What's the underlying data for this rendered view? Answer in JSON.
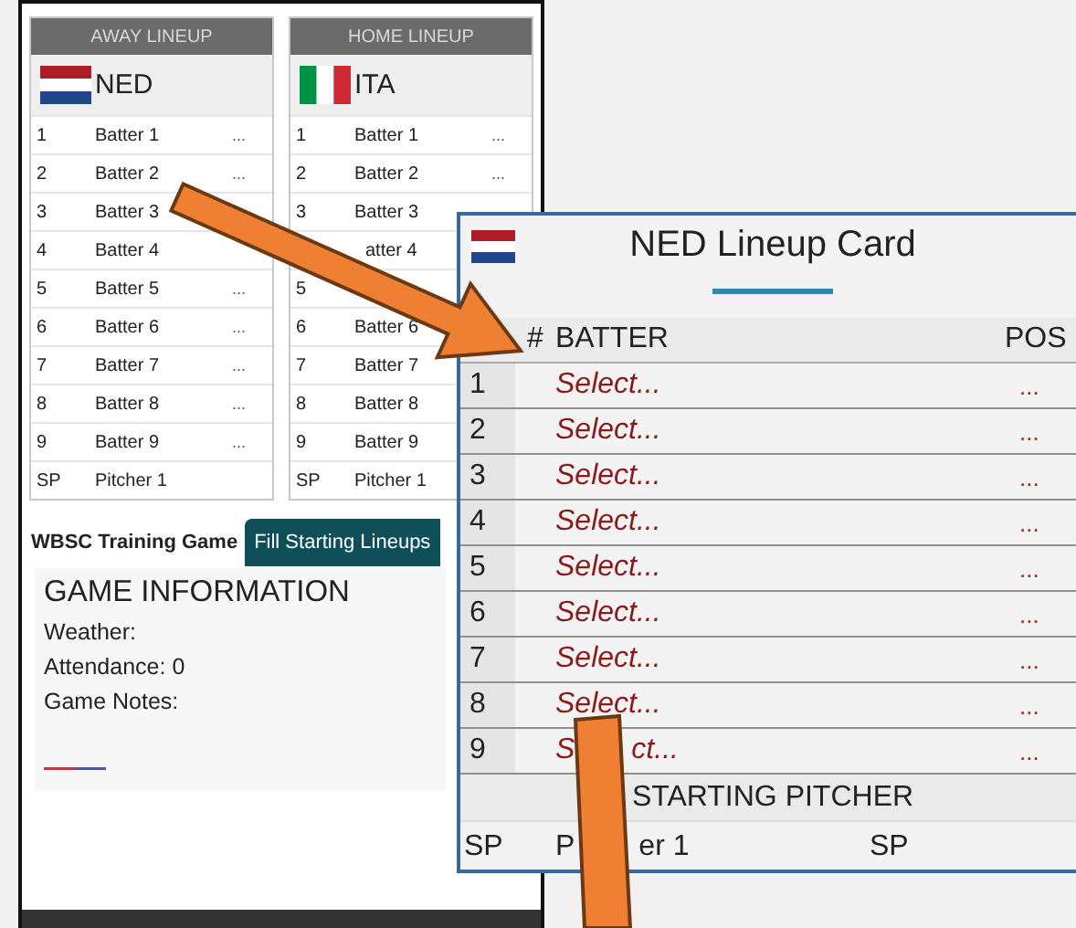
{
  "lineups": [
    {
      "heading": "AWAY LINEUP",
      "team": "NED",
      "rows": [
        {
          "num": "1",
          "name": "Batter 1",
          "pos": "..."
        },
        {
          "num": "2",
          "name": "Batter 2",
          "pos": "..."
        },
        {
          "num": "3",
          "name": "Batter 3"
        },
        {
          "num": "4",
          "name": "Batter 4"
        },
        {
          "num": "5",
          "name": "Batter 5",
          "pos": "..."
        },
        {
          "num": "6",
          "name": "Batter 6",
          "pos": "..."
        },
        {
          "num": "7",
          "name": "Batter 7",
          "pos": "..."
        },
        {
          "num": "8",
          "name": "Batter 8",
          "pos": "..."
        },
        {
          "num": "9",
          "name": "Batter 9",
          "pos": "..."
        },
        {
          "num": "SP",
          "name": "Pitcher 1"
        }
      ]
    },
    {
      "heading": "HOME LINEUP",
      "team": "ITA",
      "rows": [
        {
          "num": "1",
          "name": "Batter 1",
          "pos": "..."
        },
        {
          "num": "2",
          "name": "Batter 2",
          "pos": "..."
        },
        {
          "num": "3",
          "name": "Batter 3"
        },
        {
          "name": "atter 4"
        },
        {
          "num": "5"
        },
        {
          "num": "6",
          "name": "Batter 6"
        },
        {
          "num": "7",
          "name": "Batter 7"
        },
        {
          "num": "8",
          "name": "Batter 8"
        },
        {
          "num": "9",
          "name": "Batter 9"
        },
        {
          "num": "SP",
          "name": "Pitcher 1"
        }
      ]
    }
  ],
  "game": {
    "title": "WBSC Training Game",
    "button": "Fill Starting Lineups",
    "info_heading": "GAME INFORMATION",
    "fields": [
      "Weather:",
      "Attendance: 0",
      "Game Notes:"
    ]
  },
  "card": {
    "title": "NED Lineup Card",
    "columns": [
      "#",
      "BATTER",
      "POS"
    ],
    "rows": [
      {
        "num": "1",
        "batter": "Select...",
        "pos": "..."
      },
      {
        "num": "2",
        "batter": "Select...",
        "pos": "..."
      },
      {
        "num": "3",
        "batter": "Select...",
        "pos": "..."
      },
      {
        "num": "4",
        "batter": "Select...",
        "pos": "..."
      },
      {
        "num": "5",
        "batter": "Select...",
        "pos": "..."
      },
      {
        "num": "6",
        "batter": "Select...",
        "pos": "..."
      },
      {
        "num": "7",
        "batter": "Select...",
        "pos": "..."
      },
      {
        "num": "8",
        "batter": "Select...",
        "pos": "..."
      },
      {
        "num": "9",
        "batter_parts": [
          "S",
          "ct..."
        ],
        "pos": "..."
      }
    ],
    "pitcher_heading": "STARTING PITCHER",
    "pitcher": {
      "num": "SP",
      "name_parts": [
        "P",
        "er 1"
      ],
      "pos": "SP"
    }
  }
}
